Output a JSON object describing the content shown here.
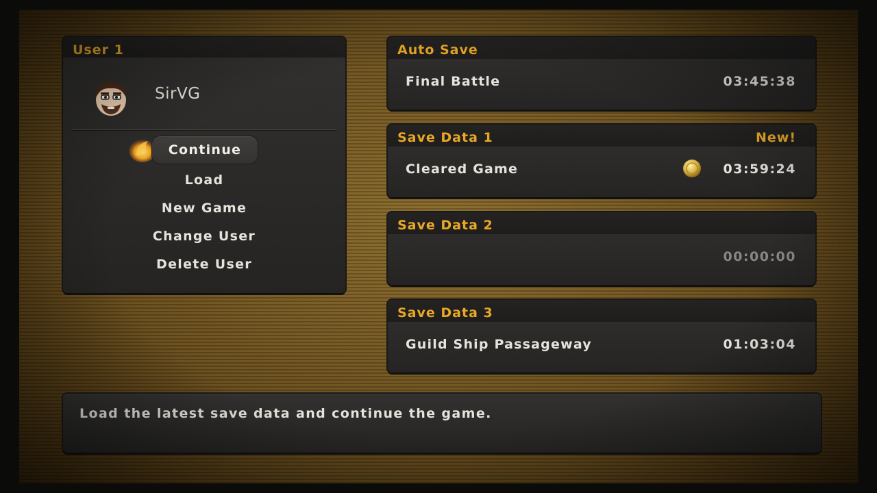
{
  "user_panel": {
    "header": "User 1",
    "username": "SirVG",
    "avatar_icon": "mii-avatar-icon",
    "cursor_icon": "flame-cursor-icon",
    "menu": {
      "continue": "Continue",
      "load": "Load",
      "new_game": "New Game",
      "change_user": "Change User",
      "delete_user": "Delete User"
    }
  },
  "saves": {
    "auto": {
      "header": "Auto Save",
      "location": "Final Battle",
      "time": "03:45:38"
    },
    "slot1": {
      "header": "Save Data 1",
      "badge": "New!",
      "location": "Cleared Game",
      "time": "03:59:24",
      "medal_icon": "gold-medal-icon"
    },
    "slot2": {
      "header": "Save Data 2",
      "location": "",
      "time": "00:00:00"
    },
    "slot3": {
      "header": "Save Data 3",
      "location": "Guild Ship Passageway",
      "time": "01:03:04"
    }
  },
  "help": {
    "text": "Load the latest save data and continue the game."
  },
  "colors": {
    "accent": "#e8a826",
    "text": "#e6e3dc",
    "panel": "#2a2928",
    "background": "#7a5c24"
  }
}
